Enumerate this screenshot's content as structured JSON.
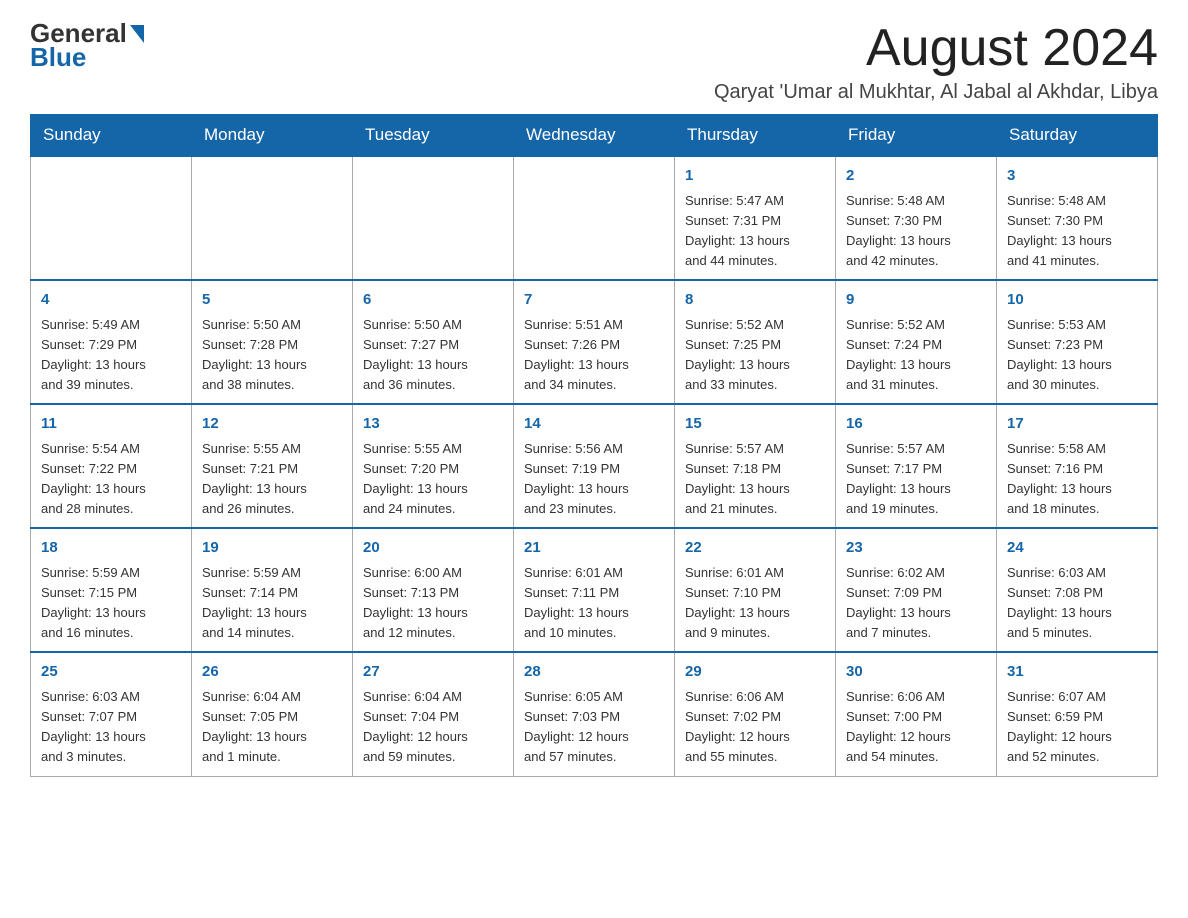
{
  "header": {
    "logo_general": "General",
    "logo_blue": "Blue",
    "month_title": "August 2024",
    "location": "Qaryat 'Umar al Mukhtar, Al Jabal al Akhdar, Libya"
  },
  "days_of_week": [
    "Sunday",
    "Monday",
    "Tuesday",
    "Wednesday",
    "Thursday",
    "Friday",
    "Saturday"
  ],
  "weeks": [
    [
      {
        "day": "",
        "info": ""
      },
      {
        "day": "",
        "info": ""
      },
      {
        "day": "",
        "info": ""
      },
      {
        "day": "",
        "info": ""
      },
      {
        "day": "1",
        "info": "Sunrise: 5:47 AM\nSunset: 7:31 PM\nDaylight: 13 hours\nand 44 minutes."
      },
      {
        "day": "2",
        "info": "Sunrise: 5:48 AM\nSunset: 7:30 PM\nDaylight: 13 hours\nand 42 minutes."
      },
      {
        "day": "3",
        "info": "Sunrise: 5:48 AM\nSunset: 7:30 PM\nDaylight: 13 hours\nand 41 minutes."
      }
    ],
    [
      {
        "day": "4",
        "info": "Sunrise: 5:49 AM\nSunset: 7:29 PM\nDaylight: 13 hours\nand 39 minutes."
      },
      {
        "day": "5",
        "info": "Sunrise: 5:50 AM\nSunset: 7:28 PM\nDaylight: 13 hours\nand 38 minutes."
      },
      {
        "day": "6",
        "info": "Sunrise: 5:50 AM\nSunset: 7:27 PM\nDaylight: 13 hours\nand 36 minutes."
      },
      {
        "day": "7",
        "info": "Sunrise: 5:51 AM\nSunset: 7:26 PM\nDaylight: 13 hours\nand 34 minutes."
      },
      {
        "day": "8",
        "info": "Sunrise: 5:52 AM\nSunset: 7:25 PM\nDaylight: 13 hours\nand 33 minutes."
      },
      {
        "day": "9",
        "info": "Sunrise: 5:52 AM\nSunset: 7:24 PM\nDaylight: 13 hours\nand 31 minutes."
      },
      {
        "day": "10",
        "info": "Sunrise: 5:53 AM\nSunset: 7:23 PM\nDaylight: 13 hours\nand 30 minutes."
      }
    ],
    [
      {
        "day": "11",
        "info": "Sunrise: 5:54 AM\nSunset: 7:22 PM\nDaylight: 13 hours\nand 28 minutes."
      },
      {
        "day": "12",
        "info": "Sunrise: 5:55 AM\nSunset: 7:21 PM\nDaylight: 13 hours\nand 26 minutes."
      },
      {
        "day": "13",
        "info": "Sunrise: 5:55 AM\nSunset: 7:20 PM\nDaylight: 13 hours\nand 24 minutes."
      },
      {
        "day": "14",
        "info": "Sunrise: 5:56 AM\nSunset: 7:19 PM\nDaylight: 13 hours\nand 23 minutes."
      },
      {
        "day": "15",
        "info": "Sunrise: 5:57 AM\nSunset: 7:18 PM\nDaylight: 13 hours\nand 21 minutes."
      },
      {
        "day": "16",
        "info": "Sunrise: 5:57 AM\nSunset: 7:17 PM\nDaylight: 13 hours\nand 19 minutes."
      },
      {
        "day": "17",
        "info": "Sunrise: 5:58 AM\nSunset: 7:16 PM\nDaylight: 13 hours\nand 18 minutes."
      }
    ],
    [
      {
        "day": "18",
        "info": "Sunrise: 5:59 AM\nSunset: 7:15 PM\nDaylight: 13 hours\nand 16 minutes."
      },
      {
        "day": "19",
        "info": "Sunrise: 5:59 AM\nSunset: 7:14 PM\nDaylight: 13 hours\nand 14 minutes."
      },
      {
        "day": "20",
        "info": "Sunrise: 6:00 AM\nSunset: 7:13 PM\nDaylight: 13 hours\nand 12 minutes."
      },
      {
        "day": "21",
        "info": "Sunrise: 6:01 AM\nSunset: 7:11 PM\nDaylight: 13 hours\nand 10 minutes."
      },
      {
        "day": "22",
        "info": "Sunrise: 6:01 AM\nSunset: 7:10 PM\nDaylight: 13 hours\nand 9 minutes."
      },
      {
        "day": "23",
        "info": "Sunrise: 6:02 AM\nSunset: 7:09 PM\nDaylight: 13 hours\nand 7 minutes."
      },
      {
        "day": "24",
        "info": "Sunrise: 6:03 AM\nSunset: 7:08 PM\nDaylight: 13 hours\nand 5 minutes."
      }
    ],
    [
      {
        "day": "25",
        "info": "Sunrise: 6:03 AM\nSunset: 7:07 PM\nDaylight: 13 hours\nand 3 minutes."
      },
      {
        "day": "26",
        "info": "Sunrise: 6:04 AM\nSunset: 7:05 PM\nDaylight: 13 hours\nand 1 minute."
      },
      {
        "day": "27",
        "info": "Sunrise: 6:04 AM\nSunset: 7:04 PM\nDaylight: 12 hours\nand 59 minutes."
      },
      {
        "day": "28",
        "info": "Sunrise: 6:05 AM\nSunset: 7:03 PM\nDaylight: 12 hours\nand 57 minutes."
      },
      {
        "day": "29",
        "info": "Sunrise: 6:06 AM\nSunset: 7:02 PM\nDaylight: 12 hours\nand 55 minutes."
      },
      {
        "day": "30",
        "info": "Sunrise: 6:06 AM\nSunset: 7:00 PM\nDaylight: 12 hours\nand 54 minutes."
      },
      {
        "day": "31",
        "info": "Sunrise: 6:07 AM\nSunset: 6:59 PM\nDaylight: 12 hours\nand 52 minutes."
      }
    ]
  ]
}
